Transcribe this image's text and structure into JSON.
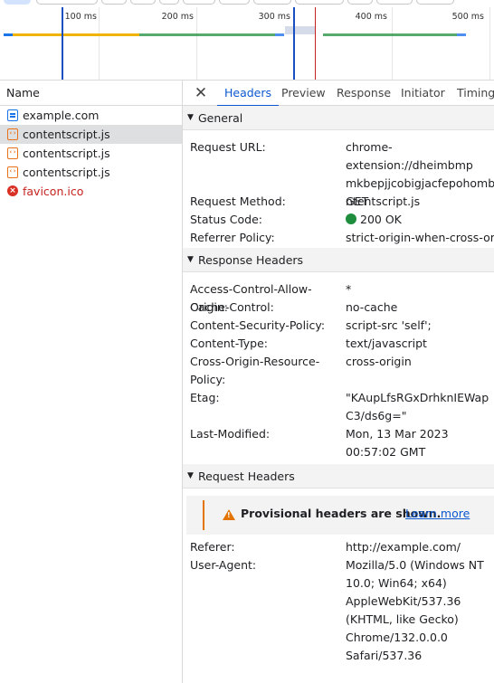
{
  "timeline": {
    "ticks": [
      "100 ms",
      "200 ms",
      "300 ms",
      "400 ms",
      "500 ms"
    ]
  },
  "requests": {
    "column_header": "Name",
    "items": [
      {
        "name": "example.com",
        "type": "document"
      },
      {
        "name": "contentscript.js",
        "type": "script"
      },
      {
        "name": "contentscript.js",
        "type": "script"
      },
      {
        "name": "contentscript.js",
        "type": "script"
      },
      {
        "name": "favicon.ico",
        "type": "error"
      }
    ]
  },
  "detail": {
    "close_label": "✕",
    "tabs": [
      "Headers",
      "Preview",
      "Response",
      "Initiator",
      "Timing"
    ],
    "general": {
      "title": "General",
      "rows": [
        {
          "key": "Request URL:",
          "value": [
            "chrome-extension://dheimbmp",
            "mkbepjjcobigjacfepohombn/co",
            "ntentscript.js"
          ]
        },
        {
          "key": "Request Method:",
          "value": [
            "GET"
          ]
        },
        {
          "key": "Status Code:",
          "value": [
            "200 OK"
          ]
        },
        {
          "key": "Referrer Policy:",
          "value": [
            "strict-origin-when-cross-origin"
          ]
        }
      ]
    },
    "response_headers": {
      "title": "Response Headers",
      "rows": [
        {
          "key": "Access-Control-Allow-Origin:",
          "value": [
            "*"
          ]
        },
        {
          "key": "Cache-Control:",
          "value": [
            "no-cache"
          ]
        },
        {
          "key": "Content-Security-Policy:",
          "value": [
            "script-src 'self';"
          ]
        },
        {
          "key": "Content-Type:",
          "value": [
            "text/javascript"
          ]
        },
        {
          "key": "Cross-Origin-Resource-Policy:",
          "key_lines": [
            "Cross-Origin-Resource-",
            "Policy:"
          ],
          "value": [
            "cross-origin"
          ]
        },
        {
          "key": "Etag:",
          "value": [
            "\"KAupLfsRGxDrhknIEWap",
            "C3/ds6g=\""
          ]
        },
        {
          "key": "Last-Modified:",
          "value": [
            "Mon, 13 Mar 2023",
            "00:57:02 GMT"
          ]
        }
      ]
    },
    "request_headers": {
      "title": "Request Headers",
      "warning": "Provisional headers are shown.",
      "learn_more": "Learn more",
      "rows": [
        {
          "key": "Referer:",
          "value": [
            "http://example.com/"
          ]
        },
        {
          "key": "User-Agent:",
          "value": [
            "Mozilla/5.0 (Windows NT",
            "10.0; Win64; x64)",
            "AppleWebKit/537.36",
            "(KHTML, like Gecko)",
            "Chrome/132.0.0.0",
            "Safari/537.36"
          ]
        }
      ]
    }
  },
  "colors": {
    "accent": "#0b57d0",
    "error": "#c5221f",
    "ok": "#1e8e3e",
    "warning": "#e37400"
  }
}
